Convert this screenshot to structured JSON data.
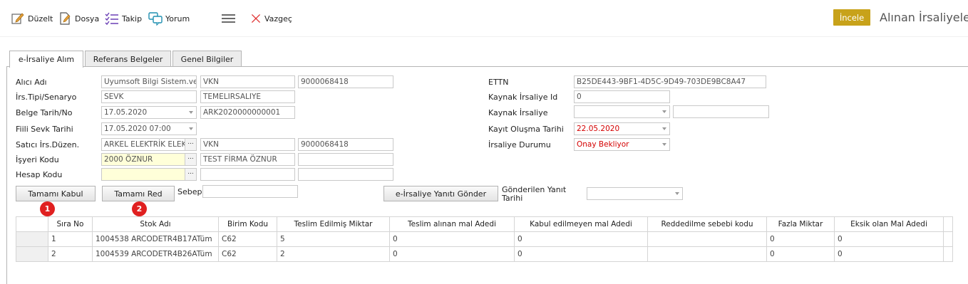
{
  "toolbar": {
    "duzelt": "Düzelt",
    "dosya": "Dosya",
    "takip": "Takip",
    "yorum": "Yorum",
    "vazgec": "Vazgeç",
    "incele": "İncele",
    "title": "Alınan İrsaliyeler"
  },
  "tabs": [
    "e-İrsaliye Alım",
    "Referans Belgeler",
    "Genel Bilgiler"
  ],
  "form": {
    "alici_adi_label": "Alıcı Adı",
    "alici_adi": "Uyumsoft Bilgi Sistem.ve",
    "alici_vkn_type": "VKN",
    "alici_vkn": "9000068418",
    "irs_tipi_label": "İrs.Tipi/Senaryo",
    "irs_tipi": "SEVK",
    "senaryo": "TEMELIRSALIYE",
    "belge_label": "Belge Tarih/No",
    "belge_tarih": "17.05.2020",
    "belge_no": "ARK2020000000001",
    "fiili_label": "Fiili Sevk Tarihi",
    "fiili_tarih": "17.05.2020 07:00",
    "satici_label": "Satıcı İrs.Düzen.",
    "satici": "ARKEL ELEKTRİK ELEKTRO",
    "satici_vkn_type": "VKN",
    "satici_vkn": "9000068418",
    "isyeri_label": "İşyeri Kodu",
    "isyeri_kodu": "2000 ÖZNUR",
    "isyeri_adi": "TEST FİRMA ÖZNUR",
    "hesap_label": "Hesap Kodu",
    "ettn_label": "ETTN",
    "ettn": "B25DE443-9BF1-4D5C-9D49-703DE9BC8A47",
    "kaynak_id_label": "Kaynak İrsaliye Id",
    "kaynak_id": "0",
    "kaynak_irs_label": "Kaynak İrsaliye",
    "kayit_label": "Kayıt Oluşma Tarihi",
    "kayit_tarih": "22.05.2020",
    "durum_label": "İrsaliye Durumu",
    "durum": "Onay Bekliyor"
  },
  "actions": {
    "tamami_kabul": "Tamamı Kabul",
    "tamami_red": "Tamamı Red",
    "sebep_label": "Sebep",
    "yanit_gonder": "e-İrsaliye Yanıtı Gönder",
    "gonderilen_label_1": "Gönderilen Yanıt",
    "gonderilen_label_2": "Tarihi",
    "badge1": "1",
    "badge2": "2"
  },
  "grid": {
    "headers": [
      "Sıra No",
      "Stok Adı",
      "Birim Kodu",
      "Teslim Edilmiş Miktar",
      "Teslim alınan mal Adedi",
      "Kabul edilmeyen mal Adedi",
      "Reddedilme sebebi kodu",
      "Fazla Miktar",
      "Eksik olan Mal Adedi"
    ],
    "rows": [
      [
        "1",
        "1004538 ARCODETR4B17ATüm",
        "C62",
        "5",
        "0",
        "0",
        "",
        "0",
        "0"
      ],
      [
        "2",
        "1004539 ARCODETR4B26ATüm",
        "C62",
        "2",
        "0",
        "0",
        "",
        "0",
        "0"
      ]
    ]
  },
  "colors": {
    "accent": "#c8a21a",
    "badge": "#e02020",
    "required": "#ffffd9",
    "alert_text": "#d40000"
  }
}
